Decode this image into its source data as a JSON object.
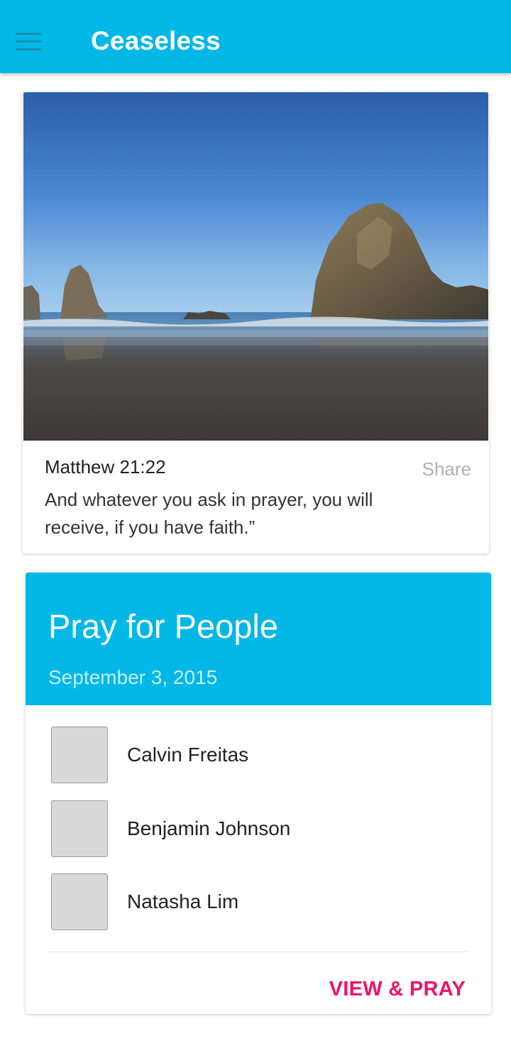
{
  "app_bar": {
    "title": "Ceaseless",
    "menu_icon": "hamburger-menu-icon",
    "background_color": "#00b7e6"
  },
  "verse_card": {
    "image": "coastal-sea-stack-photo",
    "reference": "Matthew 21:22",
    "share_label": "Share",
    "text": "And whatever you ask in prayer, you will receive, if you have faith.”"
  },
  "pray_card": {
    "title": "Pray for People",
    "date": "September 3, 2015",
    "header_color": "#00b7e6",
    "people": [
      {
        "name": "Calvin Freitas"
      },
      {
        "name": "Benjamin Johnson"
      },
      {
        "name": "Natasha Lim"
      }
    ],
    "action_label": "VIEW & PRAY",
    "action_color": "#ee1367"
  }
}
